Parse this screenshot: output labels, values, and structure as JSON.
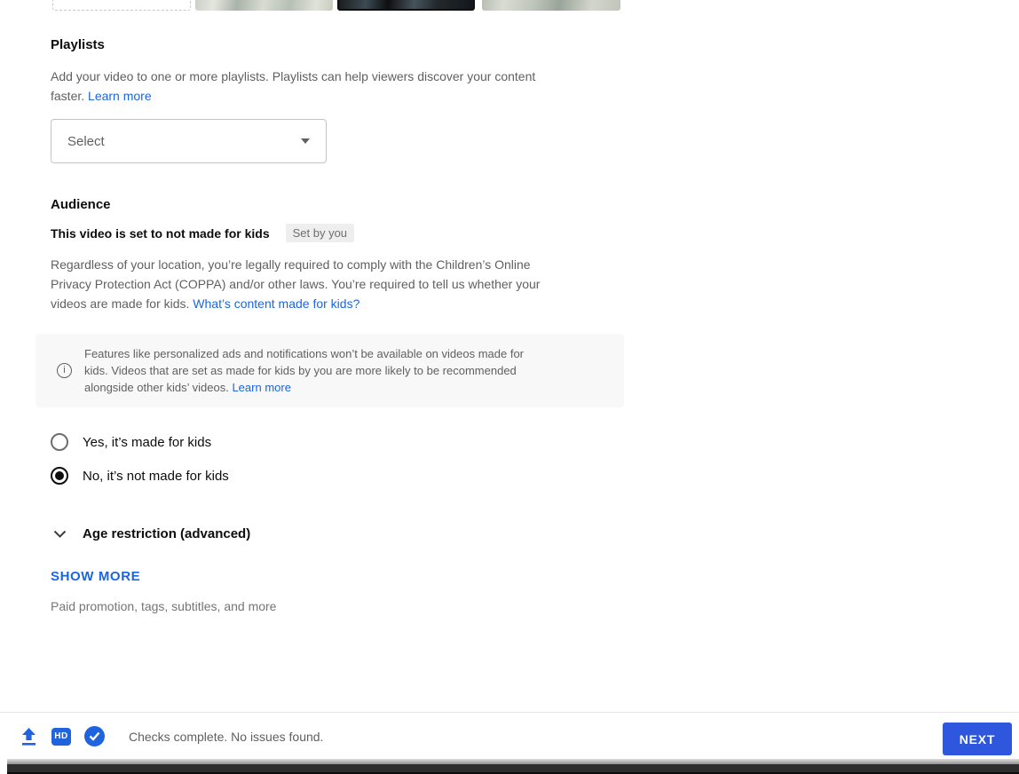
{
  "accent_colors": {
    "link_blue": "#1b66e0",
    "button_blue": "#2e57dd",
    "icon_blue": "#1f63dd"
  },
  "thumbnail_strip": {
    "items": [
      {
        "name": "upload-thumbnail-placeholder",
        "selected": false
      },
      {
        "name": "auto-thumbnail-1",
        "selected": false
      },
      {
        "name": "auto-thumbnail-2",
        "selected": true
      },
      {
        "name": "auto-thumbnail-3",
        "selected": false
      }
    ]
  },
  "playlists": {
    "title": "Playlists",
    "description_lines": [
      "Add your video to one or more playlists. Playlists can help viewers discover your content"
    ],
    "description_tail": "faster. ",
    "learn_more_label": "Learn more",
    "select_placeholder": "Select",
    "caret_icon": "caret-down-icon"
  },
  "audience": {
    "title": "Audience",
    "status_text": "This video is set to not made for kids",
    "badge_label": "Set by you",
    "description_lines": [
      "Regardless of your location, you’re legally required to comply with the Children’s Online",
      "Privacy Protection Act (COPPA) and/or other laws. You’re required to tell us whether your"
    ],
    "description_tail": "videos are made for kids. ",
    "description_link_label": "What’s content made for kids?",
    "info_icon_glyph": "i",
    "info_lines": [
      "Features like personalized ads and notifications won’t be available on videos made for",
      "kids. Videos that are set as made for kids by you are more likely to be recommended"
    ],
    "info_tail": "alongside other kids’ videos. ",
    "info_link_label": "Learn more",
    "options": [
      {
        "label": "Yes, it’s made for kids",
        "selected": false
      },
      {
        "label": "No, it’s not made for kids",
        "selected": true
      }
    ],
    "age_restriction_label": "Age restriction (advanced)"
  },
  "more_section": {
    "show_more_label": "SHOW MORE",
    "hint": "Paid promotion, tags, subtitles, and more"
  },
  "footer": {
    "hd_label": "HD",
    "status_text": "Checks complete. No issues found.",
    "next_label": "NEXT"
  }
}
